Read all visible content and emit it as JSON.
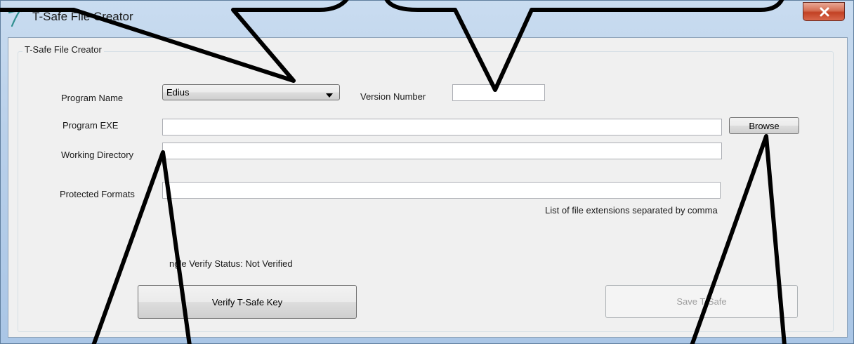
{
  "window": {
    "title": "T-Safe File Creator",
    "close_symbol": "×"
  },
  "group": {
    "title": "T-Safe File Creator"
  },
  "form": {
    "program_name_label": "Program Name",
    "program_name_value": "Edius",
    "version_number_label": "Version Number",
    "version_number_value": "",
    "program_exe_label": "Program EXE",
    "program_exe_value": "",
    "browse_label": "Browse",
    "working_directory_label": "Working Directory",
    "working_directory_value": "",
    "protected_formats_label": "Protected Formats",
    "protected_formats_value": "",
    "protected_formats_hint": "List of file extensions separated by comma",
    "dongle_status_text": "ngle Verify Status: Not Verified",
    "verify_button_label": "Verify T-Safe Key",
    "save_button_label": "Save T-Safe"
  },
  "icons": {
    "app": "t-logo-icon",
    "close": "close-icon",
    "dropdown": "dropdown-arrow-icon"
  },
  "colors": {
    "accent": "#2f8f8f",
    "close_button": "#c24124",
    "disabled_text": "#a0a0a0"
  }
}
